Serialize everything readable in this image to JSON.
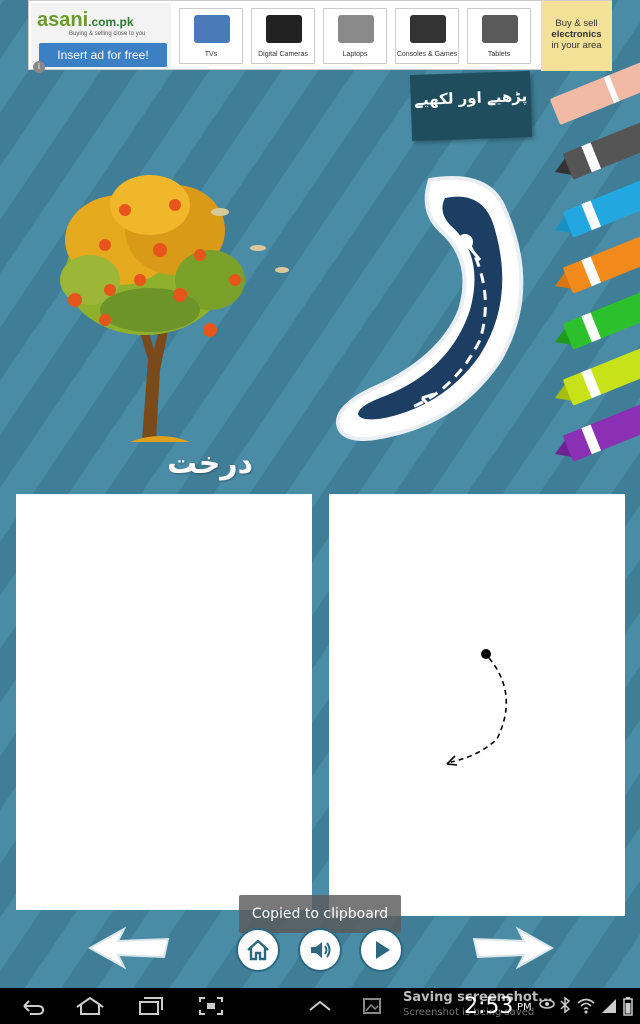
{
  "ad": {
    "brand": "asani",
    "domain": ".com.pk",
    "tagline": "Buying & selling close to you",
    "insert_label": "Insert ad for free!",
    "categories": [
      {
        "label": "TVs",
        "color": "#4a7ab8"
      },
      {
        "label": "Digital Cameras",
        "color": "#222222"
      },
      {
        "label": "Laptops",
        "color": "#8a8a8a"
      },
      {
        "label": "Consoles & Games",
        "color": "#333333"
      },
      {
        "label": "Tablets",
        "color": "#5a5a5a"
      }
    ],
    "side_line1": "Buy & sell",
    "side_line2": "electronics",
    "side_line3": "in your area"
  },
  "header": {
    "tag_label": "پڑھیے اور لکھیے"
  },
  "lesson": {
    "word": "درخت",
    "letter": "د"
  },
  "crayons": [
    {
      "color": "#f2b9a4",
      "icon": "eraser-icon"
    },
    {
      "color": "#444444",
      "icon": "crayon-black-icon"
    },
    {
      "color": "#22a7e0",
      "icon": "crayon-blue-icon"
    },
    {
      "color": "#f28a1c",
      "icon": "crayon-orange-icon"
    },
    {
      "color": "#2cc12c",
      "icon": "crayon-green-icon"
    },
    {
      "color": "#c8e21a",
      "icon": "crayon-yellow-icon"
    },
    {
      "color": "#8b2fb5",
      "icon": "crayon-purple-icon"
    }
  ],
  "toast": {
    "message": "Copied to clipboard"
  },
  "statusbar": {
    "notification_title": "Saving screenshot...",
    "notification_sub": "Screenshot is being saved",
    "time": "2:53",
    "ampm": "PM"
  },
  "colors": {
    "background": "#4a8ca6",
    "letter_fill": "#1d3e63",
    "tag_bg": "#1f4d5e"
  }
}
